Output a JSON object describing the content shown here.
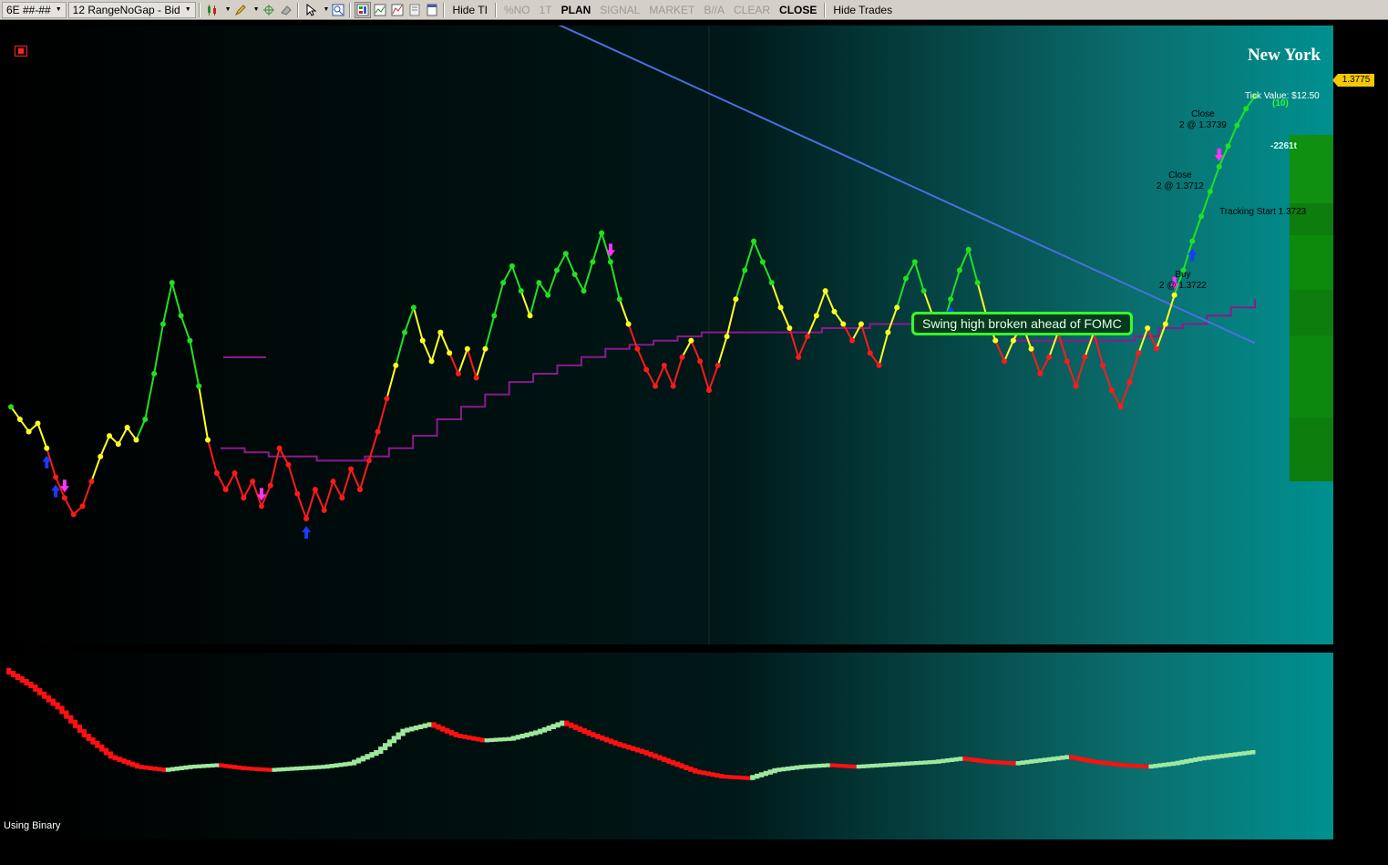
{
  "toolbar": {
    "instrument": "6E ##-##",
    "bar_type": "12 RangeNoGap - Bid",
    "icons": [
      "candlestick-icon",
      "pencil-icon",
      "crosshair-icon",
      "eraser-icon",
      "cursor-icon",
      "zoom-icon",
      "chart-trader-icon",
      "strategy-icon",
      "indicators-icon",
      "data-box-icon",
      "properties-icon"
    ],
    "hide_ti": "Hide TI",
    "pct_no": "%NO",
    "one_t": "1T",
    "plan": "PLAN",
    "signal": "SIGNAL",
    "market": "MARKET",
    "bid_ask": "B//A",
    "clear": "CLEAR",
    "close": "CLOSE",
    "hide_trades": "Hide Trades"
  },
  "chart": {
    "session": "New York",
    "last_price": "1.3775",
    "tick_value": "Tick Value: $12.50",
    "count_label": "(10)",
    "pnl_value": "-2261t",
    "tracking_start": "Tracking Start  1.3723",
    "note": "Swing high broken ahead of FOMC",
    "lower_label": "Using Binary",
    "trades": [
      {
        "line1": "Close",
        "line2": "2 @ 1.3739"
      },
      {
        "line1": "Close",
        "line2": "2 @ 1.3712"
      },
      {
        "line1": "Buy",
        "line2": "2 @ 1.3722"
      }
    ],
    "colors": {
      "up": "#22e022",
      "neutral": "#ffff22",
      "down": "#ff1a1a",
      "trend": "#8b1a8b",
      "trendline": "#4a6fe0",
      "buy_arrow": "#1a3aff",
      "sell_arrow": "#ff33ff"
    }
  },
  "chart_data": {
    "type": "line",
    "price_series": [
      1.37,
      1.3697,
      1.3694,
      1.3696,
      1.369,
      1.3683,
      1.3678,
      1.3674,
      1.3676,
      1.3682,
      1.3688,
      1.3693,
      1.3691,
      1.3695,
      1.3692,
      1.3697,
      1.3708,
      1.372,
      1.373,
      1.3722,
      1.3716,
      1.3705,
      1.3692,
      1.3684,
      1.368,
      1.3684,
      1.3678,
      1.3682,
      1.3676,
      1.3681,
      1.369,
      1.3686,
      1.3679,
      1.3673,
      1.368,
      1.3675,
      1.3682,
      1.3678,
      1.3685,
      1.368,
      1.3687,
      1.3694,
      1.3702,
      1.371,
      1.3718,
      1.3724,
      1.3716,
      1.3711,
      1.3718,
      1.3713,
      1.3708,
      1.3714,
      1.3707,
      1.3714,
      1.3722,
      1.373,
      1.3734,
      1.3728,
      1.3722,
      1.373,
      1.3727,
      1.3733,
      1.3737,
      1.3732,
      1.3728,
      1.3735,
      1.3742,
      1.3735,
      1.3726,
      1.372,
      1.3714,
      1.3709,
      1.3705,
      1.371,
      1.3705,
      1.3712,
      1.3716,
      1.3711,
      1.3704,
      1.371,
      1.3717,
      1.3726,
      1.3733,
      1.374,
      1.3735,
      1.373,
      1.3724,
      1.3719,
      1.3712,
      1.3717,
      1.3722,
      1.3728,
      1.3723,
      1.372,
      1.3716,
      1.372,
      1.3713,
      1.371,
      1.3718,
      1.3724,
      1.3731,
      1.3735,
      1.3728,
      1.3722,
      1.3718,
      1.3726,
      1.3733,
      1.3738,
      1.373,
      1.3722,
      1.3716,
      1.3711,
      1.3716,
      1.372,
      1.3714,
      1.3708,
      1.3712,
      1.3718,
      1.3711,
      1.3705,
      1.3712,
      1.3718,
      1.371,
      1.3704,
      1.37,
      1.3706,
      1.3713,
      1.3719,
      1.3714,
      1.372,
      1.3727,
      1.3733,
      1.374,
      1.3746,
      1.3752,
      1.3758,
      1.3763,
      1.3768,
      1.3772,
      1.3775
    ],
    "trend_series": [
      1.369,
      1.3689,
      1.3688,
      1.3688,
      1.3687,
      1.3687,
      1.3688,
      1.369,
      1.3693,
      1.3697,
      1.37,
      1.3703,
      1.3706,
      1.3708,
      1.371,
      1.3712,
      1.3714,
      1.3715,
      1.3716,
      1.3717,
      1.3718,
      1.3718,
      1.3718,
      1.3718,
      1.3718,
      1.3719,
      1.3719,
      1.372,
      1.372,
      1.372,
      1.372,
      1.372,
      1.3718,
      1.3716,
      1.3716,
      1.3716,
      1.3716,
      1.3716,
      1.3717,
      1.3719,
      1.372,
      1.3722,
      1.3724,
      1.3726
    ],
    "trendline": {
      "from": 1.375,
      "to": 1.3722
    },
    "histogram": [
      0.95,
      0.85,
      0.72,
      0.55,
      0.42,
      0.36,
      0.34,
      0.36,
      0.37,
      0.35,
      0.34,
      0.35,
      0.36,
      0.38,
      0.45,
      0.58,
      0.62,
      0.55,
      0.52,
      0.53,
      0.57,
      0.63,
      0.56,
      0.5,
      0.45,
      0.39,
      0.33,
      0.3,
      0.29,
      0.34,
      0.36,
      0.37,
      0.36,
      0.37,
      0.38,
      0.39,
      0.41,
      0.39,
      0.38,
      0.4,
      0.42,
      0.39,
      0.37,
      0.36,
      0.38,
      0.41,
      0.43,
      0.45
    ],
    "xlabel": "",
    "ylabel": ""
  }
}
